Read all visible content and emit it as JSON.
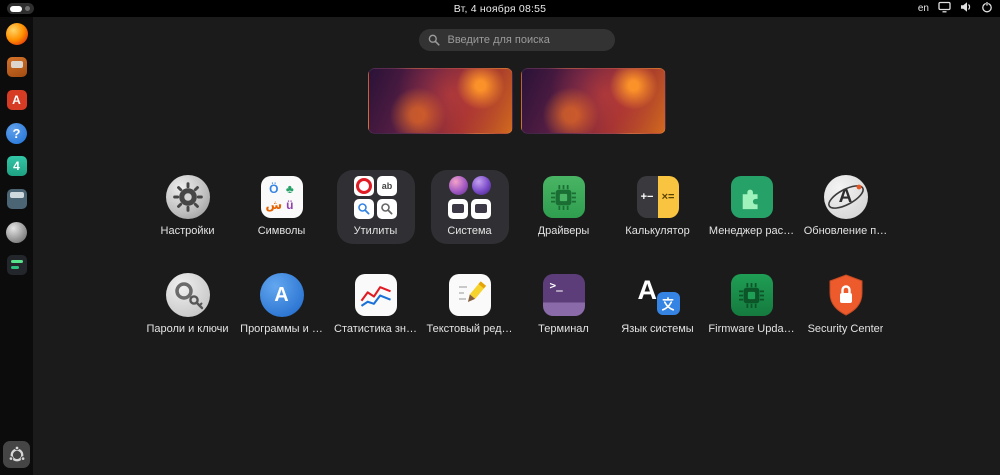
{
  "theme": {
    "background": "#1b1b1b",
    "topbar": "#000000",
    "search_bg": "#333333",
    "ubuntu_orange": "#e95420"
  },
  "topbar": {
    "clock": "Вт, 4 ноября 08:55",
    "keyboard_layout": "en",
    "status_icons": [
      "screen-share-icon",
      "volume-icon",
      "power-icon"
    ],
    "workspace_indicator": "workspace-pill"
  },
  "search": {
    "placeholder": "Введите для поиска"
  },
  "workspaces": {
    "count": 2
  },
  "dock": {
    "items": [
      {
        "icon": "firefox-icon"
      },
      {
        "icon": "orange-app-icon"
      },
      {
        "icon": "red-app-icon",
        "glyph": "A"
      },
      {
        "icon": "help-icon",
        "glyph": "?"
      },
      {
        "icon": "calendar-icon",
        "glyph": "4"
      },
      {
        "icon": "blue-gray-app-icon"
      },
      {
        "icon": "sphere-app-icon"
      },
      {
        "icon": "dark-green-app-icon"
      }
    ],
    "launcher_icon": "ubuntu-logo-icon"
  },
  "apps": [
    {
      "label": "Настройки",
      "icon": "settings-gear-icon"
    },
    {
      "label": "Символы",
      "icon": "characters-icon"
    },
    {
      "label": "Утилиты",
      "type": "folder",
      "minis": [
        "disk-usage-icon",
        "fonts-icon",
        "logs-magnifier-icon",
        "search-magnifier-icon"
      ]
    },
    {
      "label": "Система",
      "type": "folder",
      "minis": [
        "orb-icon",
        "orb-icon",
        "monitor-icon",
        "monitor-icon"
      ]
    },
    {
      "label": "Драйверы",
      "icon": "chip-icon"
    },
    {
      "label": "Калькулятор",
      "icon": "calculator-icon"
    },
    {
      "label": "Менеджер рас…",
      "icon": "puzzle-icon"
    },
    {
      "label": "Обновление п…",
      "icon": "software-updater-icon"
    },
    {
      "label": "Пароли и ключи",
      "icon": "keyring-icon"
    },
    {
      "label": "Программы и …",
      "icon": "app-center-icon"
    },
    {
      "label": "Статистика зн…",
      "icon": "usage-graph-icon"
    },
    {
      "label": "Текстовый ред…",
      "icon": "pencil-icon"
    },
    {
      "label": "Терминал",
      "icon": "terminal-icon"
    },
    {
      "label": "Язык системы",
      "icon": "language-icon"
    },
    {
      "label": "Firmware Upda…",
      "icon": "firmware-chip-icon"
    },
    {
      "label": "Security Center",
      "icon": "security-shield-icon"
    }
  ],
  "icon_glyphs": {
    "characters": [
      "Ö",
      "♣",
      "ش",
      "ü"
    ],
    "fonts_mini": "ab",
    "calculator_left": "+−",
    "calculator_right": "×=",
    "updater_letter": "A",
    "app_center_letter": "A",
    "terminal_prompt": ">_",
    "language_letter": "A",
    "dock_red": "A",
    "dock_help": "?",
    "dock_calendar": "4"
  }
}
